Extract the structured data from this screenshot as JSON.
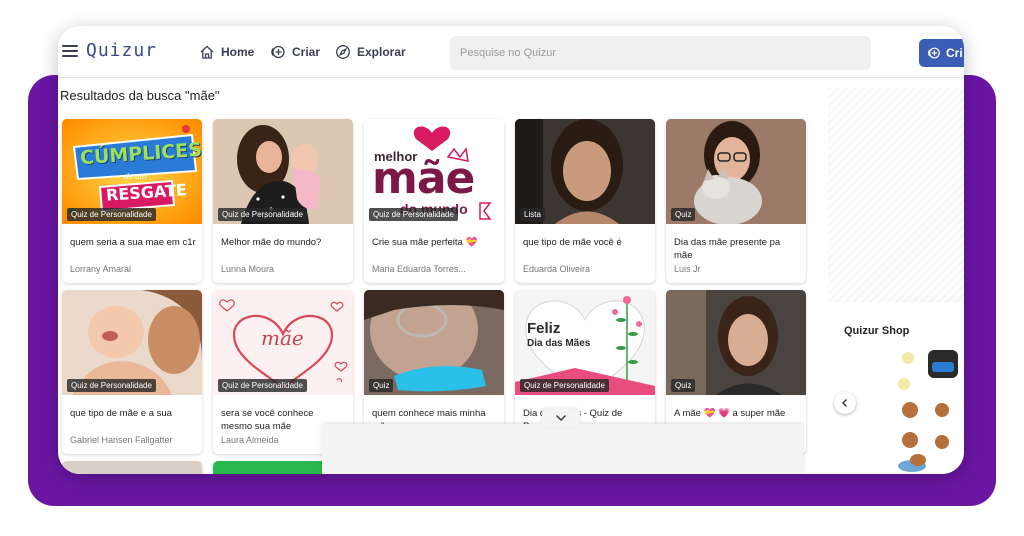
{
  "header": {
    "logo": "Quizur",
    "nav": [
      {
        "label": "Home",
        "icon": "home-icon"
      },
      {
        "label": "Criar",
        "icon": "plus-circle-icon"
      },
      {
        "label": "Explorar",
        "icon": "compass-icon"
      }
    ],
    "search_placeholder": "Pesquise no Quizur",
    "create_label": "Cri"
  },
  "results_title": "Resultados da busca \"mãe\"",
  "cards": [
    {
      "badge": "Quiz de Personalidade",
      "title": "quem seria a sua mae em c1r",
      "author": "Lorrany Amaral"
    },
    {
      "badge": "Quiz de Personalidade",
      "title": "Melhor mãe do mundo?",
      "author": "Lunna Moura"
    },
    {
      "badge": "Quiz de Personalidade",
      "title": "Crie sua mãe perfeita 💝",
      "author": "Maria Eduarda Torres..."
    },
    {
      "badge": "Lista",
      "title": "que tipo de mãe você é",
      "author": "Eduarda Oliveira"
    },
    {
      "badge": "Quiz",
      "title": "Dia das mãe presente pa mãe",
      "author": "Luis Jr"
    },
    {
      "badge": "Quiz de Personalidade",
      "title": "que tipo de mãe e a sua",
      "author": "Gabriel Hansen Fallgatter"
    },
    {
      "badge": "Quiz de Personalidade",
      "title": "sera se você conhece mesmo sua mãe",
      "author": "Laura Almeida"
    },
    {
      "badge": "Quiz",
      "title": "quem conhece mais minha mãe",
      "author": ""
    },
    {
      "badge": "Quiz de Personalidade",
      "title": "Dia das Mães - Quiz de Personalidade",
      "author": ""
    },
    {
      "badge": "Quiz",
      "title": "A mãe 💝 💗 a super mãe",
      "author": ""
    }
  ],
  "thumb_text": {
    "cumplices_line1": "CÚMPLICES",
    "cumplices_line2": "de um",
    "cumplices_line3": "RESGATE",
    "melhor": "melhor",
    "mae": "mãe",
    "do_mundo": "do mundo",
    "mae_heart": "mãe",
    "feliz": "Feliz",
    "dia_das_maes": "Dia das Mães"
  },
  "shop": {
    "title": "Quizur Shop"
  },
  "colors": {
    "purple": "#6a16a3",
    "primary": "#3b5db5",
    "logo": "#3b4a88"
  }
}
